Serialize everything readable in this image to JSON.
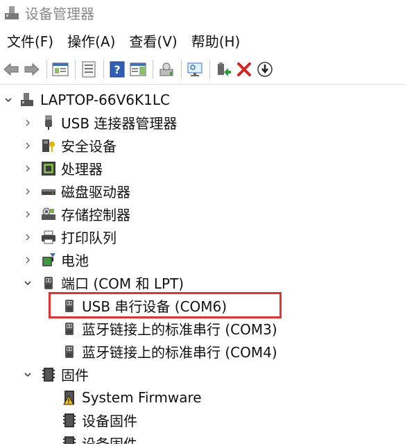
{
  "window": {
    "title": "设备管理器",
    "icon": "device-manager-icon"
  },
  "menu": [
    {
      "label": "文件(F)"
    },
    {
      "label": "操作(A)"
    },
    {
      "label": "查看(V)"
    },
    {
      "label": "帮助(H)"
    }
  ],
  "toolbar": [
    {
      "icon": "back-arrow-icon"
    },
    {
      "icon": "forward-arrow-icon"
    },
    {
      "icon": "show-hide-console-tree-icon"
    },
    {
      "icon": "properties-icon"
    },
    {
      "icon": "help-icon"
    },
    {
      "icon": "action-pane-icon"
    },
    {
      "icon": "update-driver-icon"
    },
    {
      "icon": "scan-hardware-icon"
    },
    {
      "icon": "add-driver-icon"
    },
    {
      "icon": "uninstall-device-icon"
    },
    {
      "icon": "disable-device-icon"
    }
  ],
  "tree": {
    "root": {
      "label": "LAPTOP-66V6K1LC",
      "expanded": true,
      "icon": "computer-icon"
    },
    "categories": [
      {
        "label": "USB 连接器管理器",
        "icon": "usb-connector-icon",
        "expanded": false
      },
      {
        "label": "安全设备",
        "icon": "security-device-icon",
        "expanded": false
      },
      {
        "label": "处理器",
        "icon": "processor-icon",
        "expanded": false
      },
      {
        "label": "磁盘驱动器",
        "icon": "disk-drive-icon",
        "expanded": false
      },
      {
        "label": "存储控制器",
        "icon": "storage-controller-icon",
        "expanded": false
      },
      {
        "label": "打印队列",
        "icon": "printer-icon",
        "expanded": false
      },
      {
        "label": "电池",
        "icon": "battery-icon",
        "expanded": false
      },
      {
        "label": "端口 (COM 和 LPT)",
        "icon": "port-icon",
        "expanded": true,
        "children": [
          {
            "label": "USB 串行设备 (COM6)",
            "icon": "port-icon",
            "highlighted": true
          },
          {
            "label": "蓝牙链接上的标准串行 (COM3)",
            "icon": "port-icon"
          },
          {
            "label": "蓝牙链接上的标准串行 (COM4)",
            "icon": "port-icon"
          }
        ]
      },
      {
        "label": "固件",
        "icon": "firmware-icon",
        "expanded": true,
        "children": [
          {
            "label": "System Firmware",
            "icon": "firmware-warning-icon"
          },
          {
            "label": "设备固件",
            "icon": "firmware-icon"
          },
          {
            "label": "设备固件",
            "icon": "firmware-icon"
          }
        ]
      }
    ]
  },
  "colors": {
    "highlight_border": "#e8312f",
    "title_text": "#8a8a8a"
  }
}
